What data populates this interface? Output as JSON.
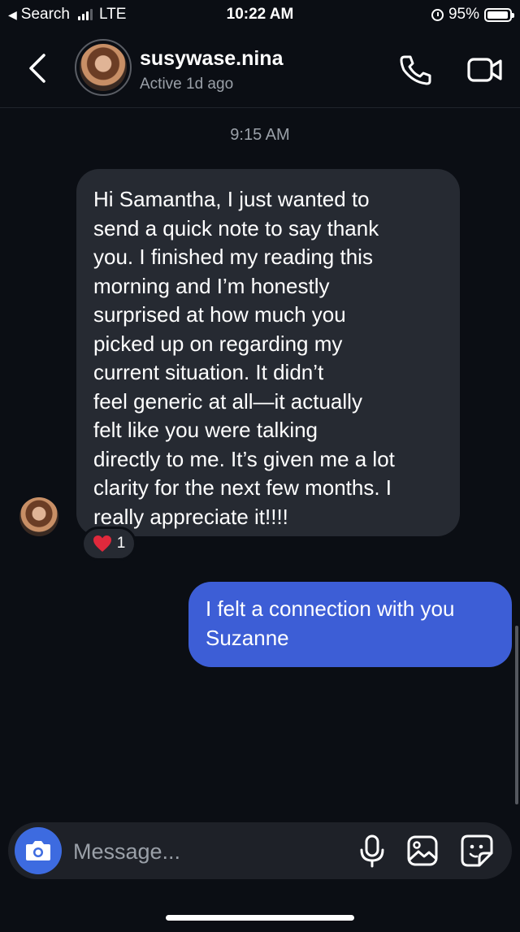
{
  "status_bar": {
    "back_app": "Search",
    "network": "LTE",
    "time": "10:22 AM",
    "battery": "95%",
    "battery_level": 0.95,
    "signal_bars_filled": 3,
    "signal_bars_total": 4
  },
  "header": {
    "username": "susywase.nina",
    "status": "Active 1d ago"
  },
  "conversation": {
    "timestamp": "9:15 AM",
    "incoming": {
      "lines": [
        "Hi Samantha, I just wanted to",
        "send a quick note to say thank",
        "you. I finished my reading this",
        "morning and I’m honestly",
        "surprised at how much you",
        "picked up on regarding my",
        "current situation. It didn’t",
        "feel generic at all—it actually",
        "felt like you were talking",
        "directly to me. It’s given me a lot",
        "clarity for the next few months. I",
        "really appreciate it!!!!"
      ],
      "reaction": {
        "emoji_icon": "heart-icon",
        "count": "1"
      }
    },
    "outgoing": {
      "lines": [
        "I felt a connection with you",
        "Suzanne"
      ]
    }
  },
  "composer": {
    "placeholder": "Message..."
  },
  "colors": {
    "background": "#0b0e14",
    "incoming_bubble": "#262a32",
    "outgoing_bubble": "#3d5ed6",
    "camera_button": "#3d6be0",
    "heart": "#e0293c"
  }
}
